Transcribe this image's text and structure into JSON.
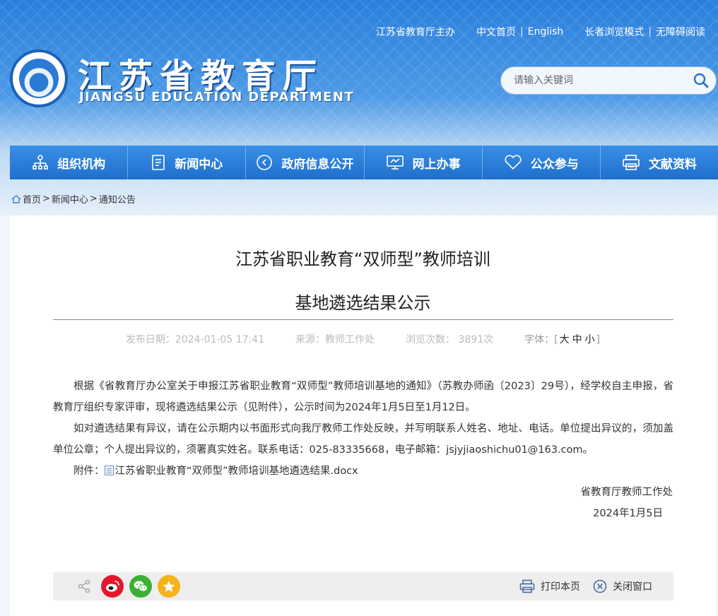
{
  "header": {
    "top_links": {
      "sponsor": "江苏省教育厅主办",
      "home": "中文首页",
      "separator": "|",
      "english": "English",
      "elder_mode": "长者浏览模式",
      "accessible": "无障碍阅读"
    },
    "site_title": "江苏省教育厅",
    "site_subtitle": "JIANGSU EDUCATION DEPARTMENT",
    "search": {
      "placeholder": "请输入关键词"
    }
  },
  "nav": {
    "items": [
      {
        "label": "组织机构",
        "icon": "org-chart-icon"
      },
      {
        "label": "新闻中心",
        "icon": "document-icon"
      },
      {
        "label": "政府信息公开",
        "icon": "info-icon"
      },
      {
        "label": "网上办事",
        "icon": "monitor-icon"
      },
      {
        "label": "公众参与",
        "icon": "heart-icon"
      },
      {
        "label": "文献资料",
        "icon": "printer-icon"
      }
    ]
  },
  "breadcrumb": {
    "home": "首页",
    "sep": ">",
    "news": "新闻中心",
    "notice": "通知公告"
  },
  "article": {
    "title_line1": "江苏省职业教育“双师型”教师培训",
    "title_line2": "基地遴选结果公示",
    "meta": {
      "date": "发布日期：2024-01-05 17:41",
      "source": "来源：教师工作处",
      "views": "浏览次数： 3891次",
      "font_label": "字体：",
      "bracket_open": "[",
      "font_large": "大",
      "font_medium": "中",
      "font_small": "小",
      "bracket_close": "]"
    },
    "paragraph1": "根据《省教育厅办公室关于申报江苏省职业教育“双师型”教师培训基地的通知》（苏教办师函〔2023〕29号），经学校自主申报，省教育厅组织专家评审，现将遴选结果公示（见附件），公示时间为2024年1月5日至1月12日。",
    "paragraph2": "如对遴选结果有异议，请在公示期内以书面形式向我厅教师工作处反映，并写明联系人姓名、地址、电话。单位提出异议的，须加盖单位公章；个人提出异议的，须署真实姓名。联系电话：025-83335668，电子邮箱：jsjyjiaoshichu01@163.com。",
    "attachment_label": "附件：",
    "attachment_name": "江苏省职业教育“双师型”教师培训基地遴选结果.docx",
    "signature_org": "省教育厅教师工作处",
    "signature_date": "2024年1月5日"
  },
  "share_bar": {
    "print_label": "打印本页",
    "close_label": "关闭窗口"
  },
  "colors": {
    "nav_blue": "#2a7ddb",
    "weibo_red": "#e6162d",
    "wechat_green": "#3cb034",
    "qzone_yellow": "#f5b21b"
  }
}
